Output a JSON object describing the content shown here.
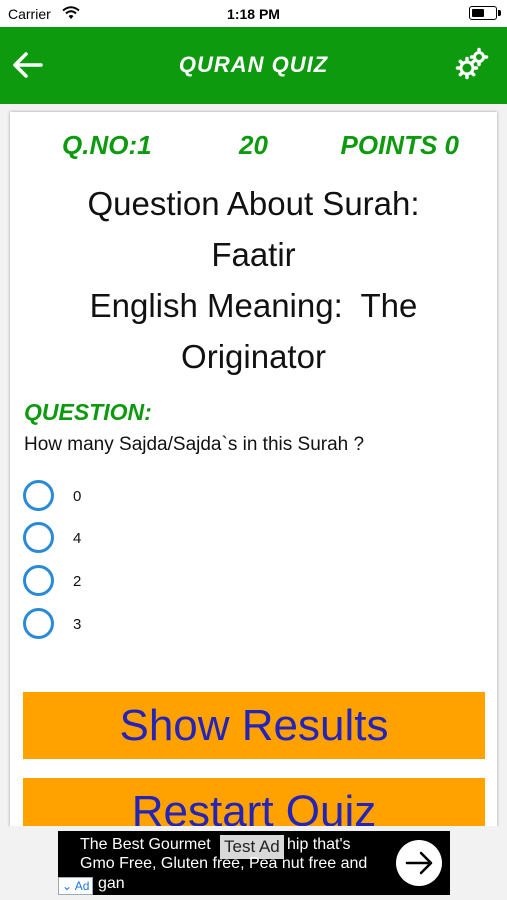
{
  "status_bar": {
    "carrier": "Carrier",
    "time": "1:18 PM"
  },
  "navbar": {
    "title": "QURAN QUIZ",
    "back_icon": "arrow-left-icon",
    "settings_icon": "gears-icon"
  },
  "quiz": {
    "qno": "Q.NO:1",
    "timer": "20",
    "points": "POINTS 0",
    "surah_line": "Question About Surah:",
    "surah_name": "Faatir",
    "meaning_line": "English Meaning:  The",
    "meaning_value": "Originator",
    "question_heading": "QUESTION:",
    "question_text": "How many Sajda/Sajda`s in this Surah ?",
    "options": [
      "0",
      "4",
      "2",
      "3"
    ]
  },
  "buttons": {
    "show_results": "Show Results",
    "restart": "Restart Quiz"
  },
  "ad": {
    "line1": "The Best Gourmet",
    "line1b": "hip that's",
    "line2": "Gmo Free, Gluten free, Pea nut free and",
    "line3": "gan",
    "test_label": "Test Ad",
    "badge": "Ad"
  },
  "colors": {
    "green": "#0e9a0e",
    "orange": "#ffa200",
    "button_text": "#2424b8",
    "radio": "#2a8ad8"
  }
}
